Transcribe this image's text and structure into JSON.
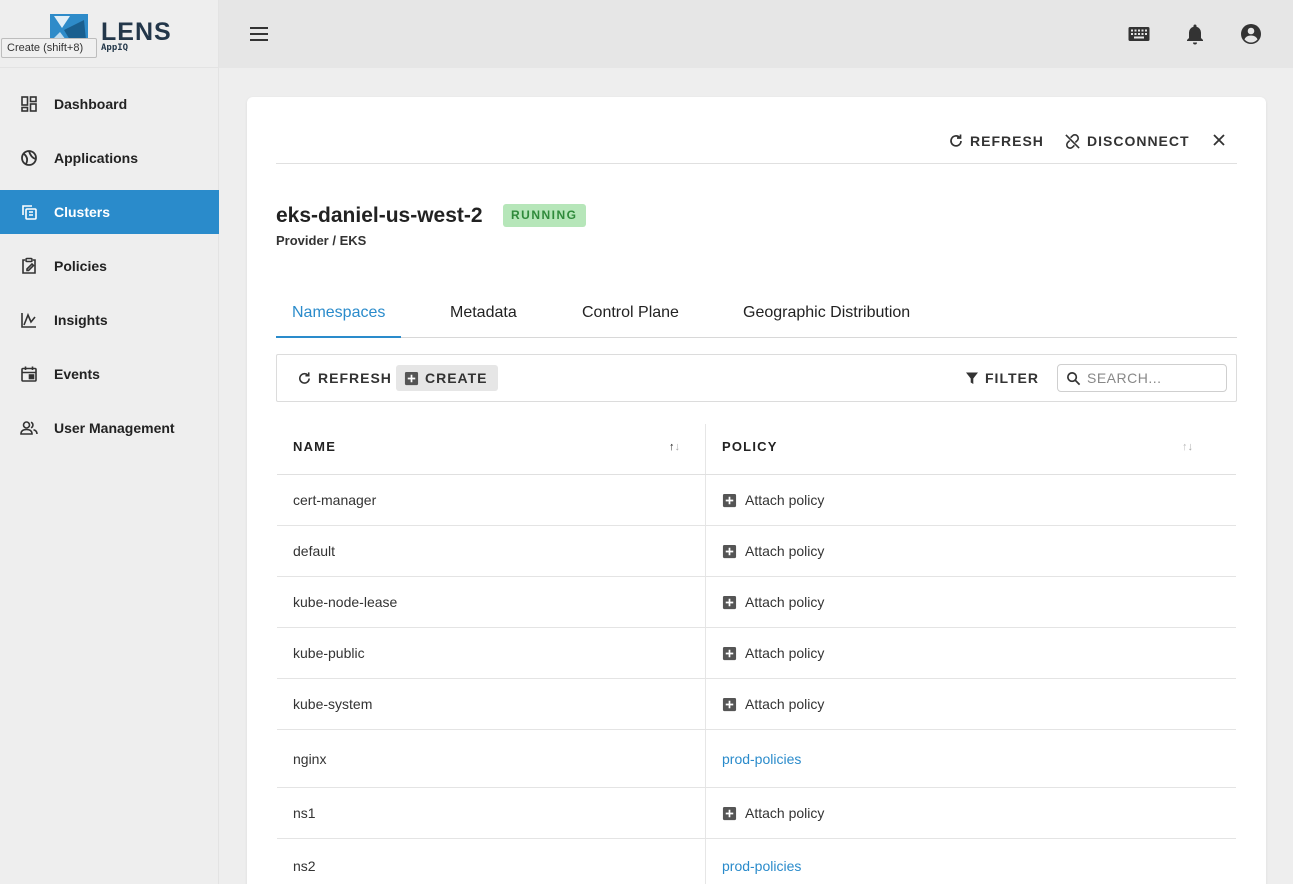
{
  "brand": {
    "name": "LENS",
    "sub": "AppIQ"
  },
  "tooltip": "Create (shift+8)",
  "colors": {
    "accent": "#2a8bcb",
    "running_bg": "#b6e6b9",
    "running_text": "#2f8a3a"
  },
  "sidebar": {
    "items": [
      {
        "label": "Dashboard",
        "icon": "dashboard-icon"
      },
      {
        "label": "Applications",
        "icon": "applications-icon"
      },
      {
        "label": "Clusters",
        "icon": "clusters-icon",
        "active": true
      },
      {
        "label": "Policies",
        "icon": "policies-icon"
      },
      {
        "label": "Insights",
        "icon": "insights-icon"
      },
      {
        "label": "Events",
        "icon": "events-icon"
      },
      {
        "label": "User Management",
        "icon": "users-icon"
      }
    ]
  },
  "topbar": {
    "icons": [
      "menu-icon",
      "keyboard-icon",
      "bell-icon",
      "account-icon"
    ]
  },
  "card": {
    "refresh_label": "REFRESH",
    "disconnect_label": "DISCONNECT",
    "cluster_name": "eks-daniel-us-west-2",
    "status": "RUNNING",
    "provider": "Provider / EKS"
  },
  "tabs": [
    {
      "label": "Namespaces",
      "active": true
    },
    {
      "label": "Metadata"
    },
    {
      "label": "Control Plane"
    },
    {
      "label": "Geographic Distribution"
    }
  ],
  "toolbar": {
    "refresh_label": "REFRESH",
    "create_label": "CREATE",
    "filter_label": "FILTER",
    "search_placeholder": "SEARCH..."
  },
  "table": {
    "columns": [
      "NAME",
      "POLICY"
    ],
    "rows": [
      {
        "name": "cert-manager",
        "policy": "Attach policy",
        "linked": false
      },
      {
        "name": "default",
        "policy": "Attach policy",
        "linked": false
      },
      {
        "name": "kube-node-lease",
        "policy": "Attach policy",
        "linked": false
      },
      {
        "name": "kube-public",
        "policy": "Attach policy",
        "linked": false
      },
      {
        "name": "kube-system",
        "policy": "Attach policy",
        "linked": false
      },
      {
        "name": "nginx",
        "policy": "prod-policies",
        "linked": true
      },
      {
        "name": "ns1",
        "policy": "Attach policy",
        "linked": false
      },
      {
        "name": "ns2",
        "policy": "prod-policies",
        "linked": true
      }
    ]
  }
}
